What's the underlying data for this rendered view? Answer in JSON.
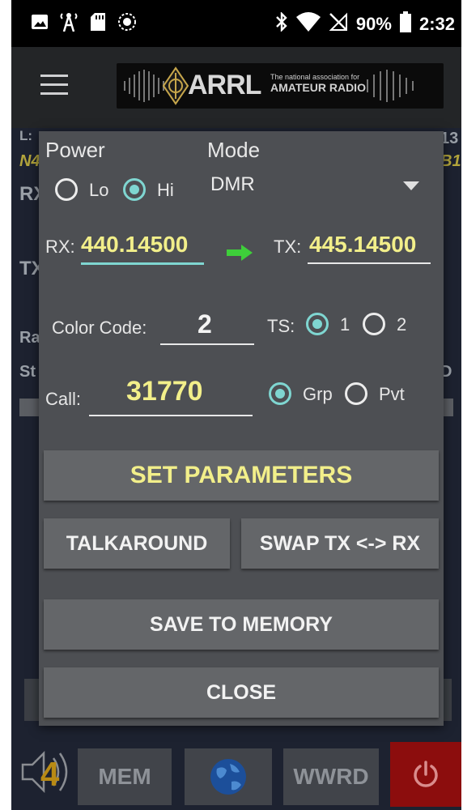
{
  "status_bar": {
    "battery_percent": "90%",
    "time": "2:32",
    "icons": [
      "image-icon",
      "radio-tower-icon",
      "sd-card-icon",
      "sync-icon",
      "bluetooth-icon",
      "wifi-icon",
      "no-sim-icon",
      "battery-icon"
    ]
  },
  "toolbar": {
    "banner_title": "ARRL",
    "banner_tagline_small": "The national association for",
    "banner_tagline": "AMATEUR RADIO"
  },
  "background": {
    "rows": [
      "L:",
      "N4",
      "RX",
      "TX",
      "Ra",
      "St"
    ],
    "right_text": [
      "13",
      "B1",
      "D"
    ]
  },
  "dialog": {
    "power_label": "Power",
    "power_options": [
      {
        "label": "Lo",
        "selected": false
      },
      {
        "label": "Hi",
        "selected": true
      }
    ],
    "mode_label": "Mode",
    "mode_value": "DMR",
    "rx_label": "RX:",
    "rx_value": "440.14500",
    "tx_label": "TX:",
    "tx_value": "445.14500",
    "color_code_label": "Color Code:",
    "color_code_value": "2",
    "ts_label": "TS:",
    "ts_options": [
      {
        "label": "1",
        "selected": true
      },
      {
        "label": "2",
        "selected": false
      }
    ],
    "call_label": "Call:",
    "call_value": "31770",
    "call_type_options": [
      {
        "label": "Grp",
        "selected": true
      },
      {
        "label": "Pvt",
        "selected": false
      }
    ],
    "buttons": {
      "set_parameters": "SET PARAMETERS",
      "talkaround": "TALKAROUND",
      "swap": "SWAP TX <-> RX",
      "save_to_memory": "SAVE TO MEMORY",
      "close": "CLOSE"
    }
  },
  "bottom_nav": {
    "volume_level": "4",
    "mem_label": "MEM",
    "wwrd_label": "WWRD"
  },
  "colors": {
    "accent_teal": "#7fd6d1",
    "value_yellow": "#f2ef8a",
    "arrow_green": "#3ecf3a",
    "power_red": "#8c0d0d",
    "dialog_bg": "#4d4f53"
  }
}
